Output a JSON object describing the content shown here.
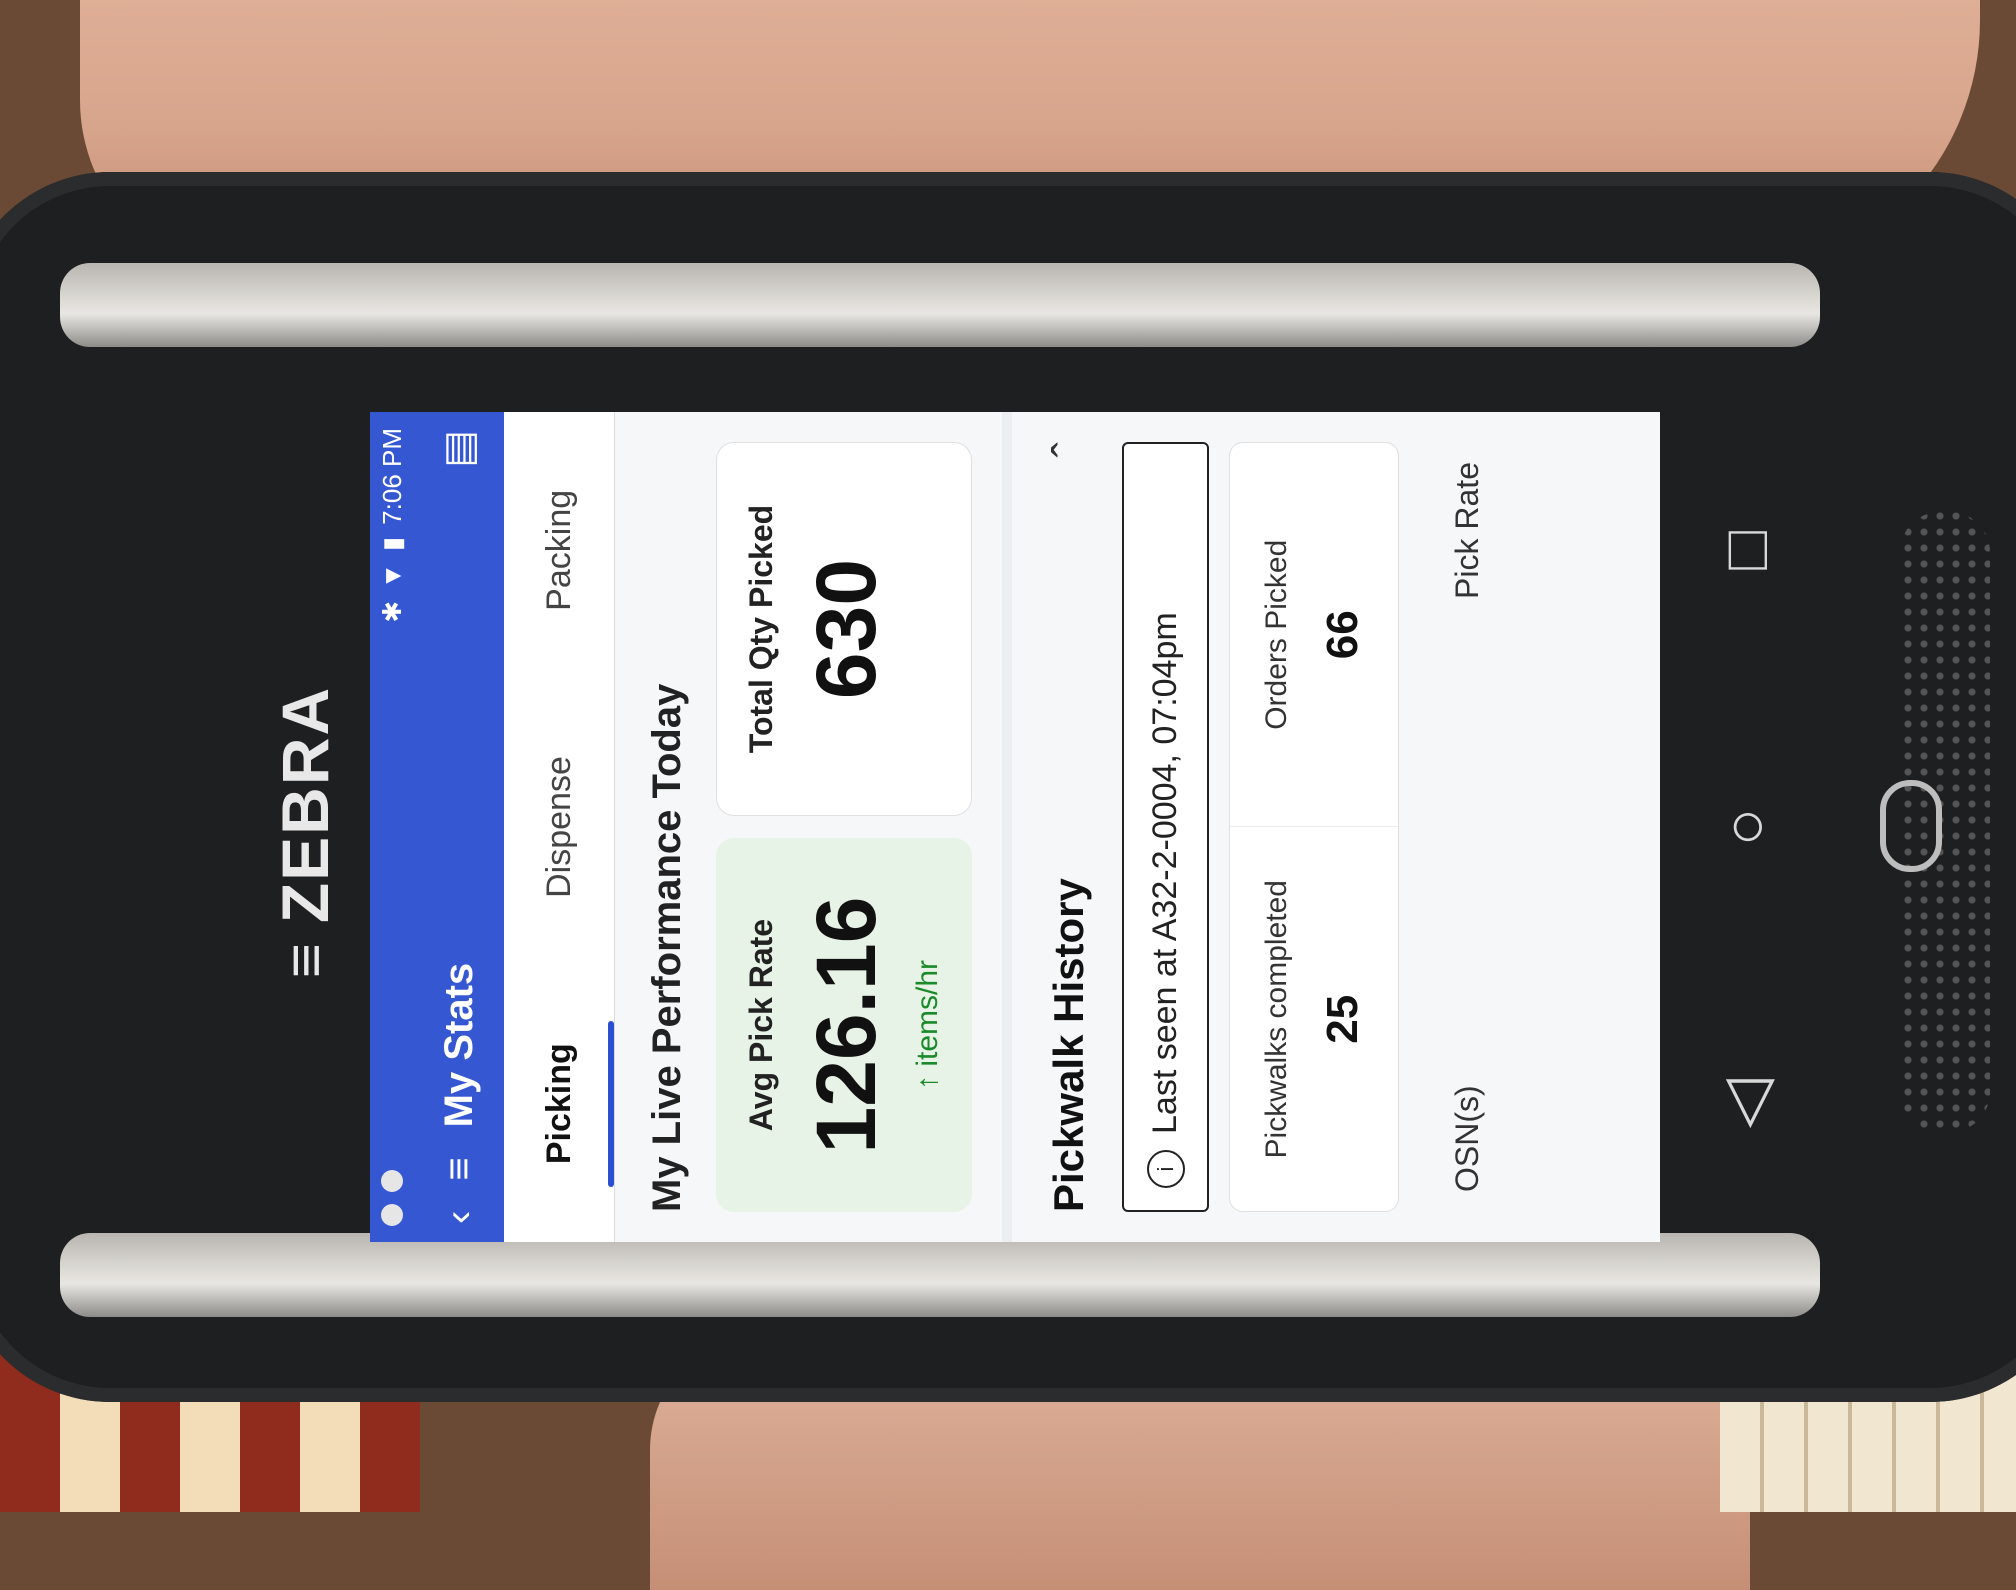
{
  "device": {
    "brand": "ZEBRA"
  },
  "status_bar": {
    "time": "7:06 PM"
  },
  "app_bar": {
    "title": "My Stats",
    "back_icon": "back-chevron-icon",
    "menu_icon": "hamburger-icon",
    "chat_icon": "chat-icon"
  },
  "tabs": [
    {
      "label": "Picking",
      "active": true
    },
    {
      "label": "Dispense",
      "active": false
    },
    {
      "label": "Packing",
      "active": false
    }
  ],
  "performance": {
    "title": "My Live Performance Today",
    "avg_pick_rate": {
      "label": "Avg Pick Rate",
      "value": "126.16",
      "unit": "↑ items/hr"
    },
    "total_qty": {
      "label": "Total Qty Picked",
      "value": "630"
    }
  },
  "history": {
    "title": "Pickwalk History",
    "last_seen": "Last seen at A32-2-0004, 07:04pm",
    "pickwalks_completed": {
      "label": "Pickwalks completed",
      "value": "25"
    },
    "orders_picked": {
      "label": "Orders Picked",
      "value": "66"
    },
    "columns": [
      "OSN(s)",
      "Pick Rate"
    ]
  },
  "colors": {
    "app_bar": "#3557d2",
    "accent_green": "#1a8a2a"
  }
}
